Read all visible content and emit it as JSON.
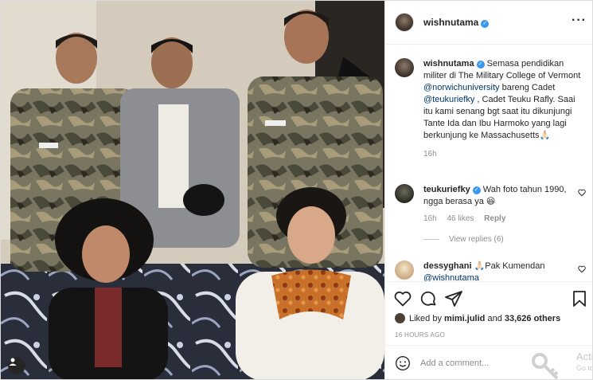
{
  "post": {
    "username": "wishnutama",
    "verified_icon": "verified-badge-icon",
    "more_icon": "more-options-icon"
  },
  "caption": {
    "username": "wishnutama",
    "text_part1": "Semasa pendidikan militer di The Military College of Vermont ",
    "mention1": "@norwichuniversity",
    "text_part2": " bareng Cadet ",
    "mention2": "@teukuriefky",
    "text_part3": " , Cadet Teuku Rafly. Saai itu kami senang bgt saat itu dikunjungi Tante Ida dan Ibu Harmoko yang lagi berkunjung ke Massachusetts🙏🏻",
    "time": "16h"
  },
  "comments": [
    {
      "username": "teukuriefky",
      "text": "Wah foto tahun 1990, ngga berasa ya 😆",
      "time": "16h",
      "likes": "46 likes",
      "reply": "Reply",
      "view_replies": "View replies (6)"
    },
    {
      "username": "dessyghani",
      "text": "🙏🏻Pak Kumendan",
      "mention": "@wishnutama"
    }
  ],
  "actions": {
    "like_icon": "heart-icon",
    "comment_icon": "comment-icon",
    "share_icon": "paper-plane-icon",
    "save_icon": "bookmark-icon"
  },
  "likes": {
    "prefix": "Liked by ",
    "user": "mimi.julid",
    "middle": " and ",
    "count": "33,626 others"
  },
  "timestamp": "16 HOURS AGO",
  "add_comment": {
    "placeholder": "Add a comment...",
    "emoji_icon": "smiley-icon"
  },
  "watermark": {
    "line1": "Acti",
    "line2": "Go to"
  },
  "colors": {
    "link": "#00376b",
    "verified": "#3897f0",
    "muted": "#8e8e8e"
  }
}
